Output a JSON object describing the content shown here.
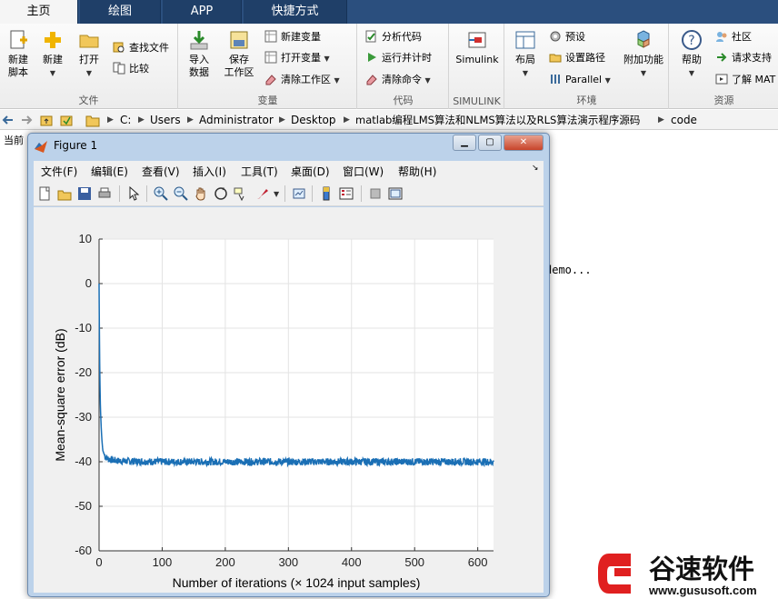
{
  "tabs": [
    {
      "label": "主页",
      "active": true
    },
    {
      "label": "绘图",
      "active": false
    },
    {
      "label": "APP",
      "active": false
    },
    {
      "label": "快捷方式",
      "active": false
    }
  ],
  "ribbon": {
    "file": {
      "label": "文件",
      "new_script": "新建\n脚本",
      "new": "新建",
      "open": "打开",
      "find_files": "查找文件",
      "compare": "比较"
    },
    "variable": {
      "label": "变量",
      "import": "导入\n数据",
      "save_ws": "保存\n工作区",
      "new_var": "新建变量",
      "open_var": "打开变量",
      "clear_ws": "清除工作区"
    },
    "code": {
      "label": "代码",
      "analyze": "分析代码",
      "run_time": "运行并计时",
      "clear_cmd": "清除命令"
    },
    "simulink": {
      "label": "SIMULINK",
      "btn": "Simulink"
    },
    "env": {
      "label": "环境",
      "layout": "布局",
      "prefs": "预设",
      "set_path": "设置路径",
      "parallel": "Parallel",
      "addons": "附加功能"
    },
    "resources": {
      "label": "资源",
      "help": "帮助",
      "community": "社区",
      "support": "请求支持",
      "learn": "了解 MAT"
    }
  },
  "address": {
    "crumbs": [
      "C:",
      "Users",
      "Administrator",
      "Desktop",
      "matlab编程LMS算法和NLMS算法以及RLS算法演示程序源码",
      "code"
    ]
  },
  "background": {
    "current_label": "当前",
    "console_text": "demo..."
  },
  "figure": {
    "title": "Figure 1",
    "menus": [
      "文件(F)",
      "编辑(E)",
      "查看(V)",
      "插入(I)",
      "工具(T)",
      "桌面(D)",
      "窗口(W)",
      "帮助(H)"
    ],
    "colors": {
      "line": "#1a6fb5"
    }
  },
  "chart_data": {
    "type": "line",
    "title": "",
    "xlabel": "Number of iterations (× 1024 input samples)",
    "ylabel": "Mean-square error (dB)",
    "xlim": [
      0,
      625
    ],
    "ylim": [
      -60,
      10
    ],
    "xticks": [
      0,
      100,
      200,
      300,
      400,
      500,
      600
    ],
    "yticks": [
      10,
      0,
      -10,
      -20,
      -30,
      -40,
      -50,
      -60
    ],
    "grid": true,
    "series": [
      {
        "x": [
          0,
          1,
          2,
          3,
          4,
          5,
          6,
          8,
          10,
          12,
          15,
          20,
          30,
          50,
          100,
          200,
          300,
          400,
          500,
          600,
          625
        ],
        "values": [
          0,
          -18,
          -27,
          -31,
          -34,
          -36,
          -37.5,
          -38.3,
          -38.8,
          -39.1,
          -39.4,
          -39.6,
          -39.8,
          -39.9,
          -40,
          -40,
          -40,
          -40,
          -40,
          -40,
          -40
        ]
      }
    ]
  },
  "watermark": {
    "brand": "谷速软件",
    "url": "www.gususoft.com"
  }
}
